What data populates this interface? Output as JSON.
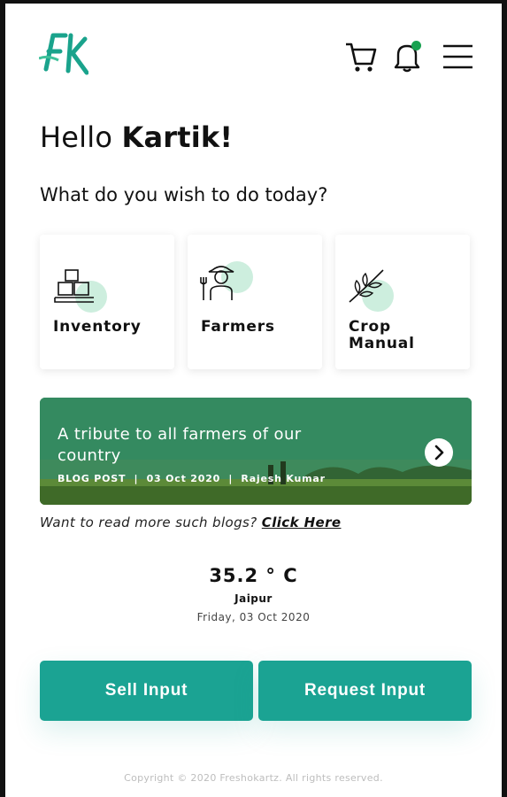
{
  "header": {
    "logo_text": "FK",
    "cart_icon": "cart-icon",
    "bell_icon": "bell-icon",
    "menu_icon": "hamburger-menu-icon",
    "notification_dot_color": "#19a150"
  },
  "greeting": {
    "prefix": "Hello ",
    "name": "Kartik!"
  },
  "question": "What do you wish to do today?",
  "cards": [
    {
      "label": "Inventory",
      "icon": "inventory-boxes-icon"
    },
    {
      "label": "Farmers",
      "icon": "farmer-icon"
    },
    {
      "label_line1": "Crop",
      "label_line2": "Manual",
      "icon": "leaf-branch-icon"
    }
  ],
  "banner": {
    "title": "A tribute to all farmers of our country",
    "meta": "BLOG POST  |  03 Oct 2020  |  Rajesh Kumar",
    "next_icon": "chevron-right-icon"
  },
  "more_blogs": {
    "text": "Want to read more such blogs? ",
    "link": "Click Here"
  },
  "weather": {
    "temperature": "35.2 ° C",
    "city": "Jaipur",
    "date": "Friday, 03 Oct 2020"
  },
  "actions": {
    "sell": "Sell Input",
    "request": "Request Input"
  },
  "footer": "Copyright © 2020 Freshokartz. All rights reserved.",
  "colors": {
    "accent": "#1ba393",
    "icon_blob": "#cdeede"
  }
}
